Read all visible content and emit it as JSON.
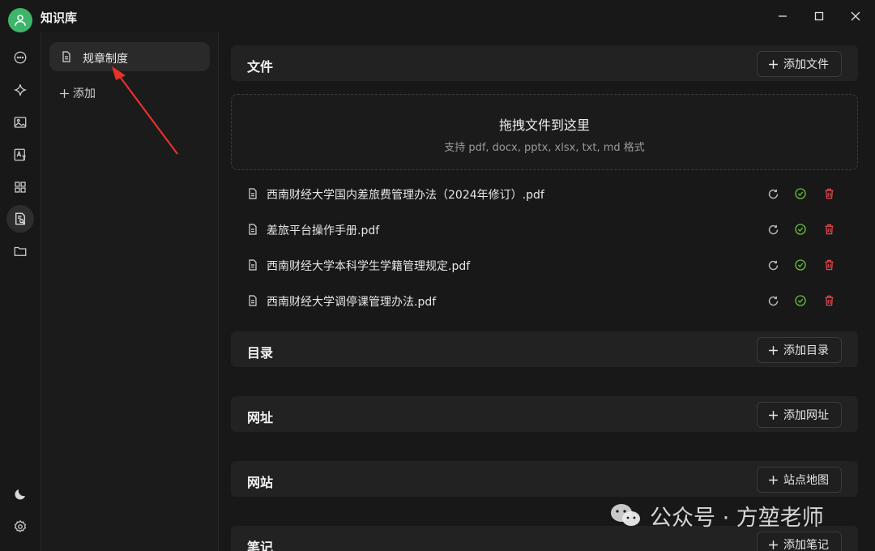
{
  "app": {
    "title": "知识库"
  },
  "window_controls": [
    "minimize",
    "maximize",
    "close"
  ],
  "rail": {
    "top_icons": [
      "chat-icon",
      "sparkle-icon",
      "image-icon",
      "translate-icon",
      "apps-icon",
      "knowledge-icon",
      "folder-icon"
    ],
    "active": "knowledge-icon",
    "bottom_icons": [
      "moon-icon",
      "settings-icon"
    ]
  },
  "kb_list": {
    "items": [
      {
        "label": "规章制度",
        "icon": "document-icon",
        "selected": true
      }
    ],
    "add_label": "添加"
  },
  "sections": {
    "files": {
      "title": "文件",
      "button": "添加文件"
    },
    "directory": {
      "title": "目录",
      "button": "添加目录"
    },
    "urls": {
      "title": "网址",
      "button": "添加网址"
    },
    "website": {
      "title": "网站",
      "button": "站点地图"
    },
    "notes": {
      "title": "笔记",
      "button": "添加笔记"
    }
  },
  "dropzone": {
    "title": "拖拽文件到这里",
    "subtitle": "支持 pdf, docx, pptx, xlsx, txt, md 格式"
  },
  "files": [
    {
      "name": "西南财经大学国内差旅费管理办法（2024年修订）.pdf"
    },
    {
      "name": "差旅平台操作手册.pdf"
    },
    {
      "name": "西南财经大学本科学生学籍管理规定.pdf"
    },
    {
      "name": "西南财经大学调停课管理办法.pdf"
    }
  ],
  "file_actions": [
    "refresh-icon",
    "check-circle-icon",
    "trash-icon"
  ],
  "colors": {
    "accent_green": "#3fb56b",
    "check_green": "#67c23a",
    "delete_red": "#e5484d",
    "annotation_red": "#e8302a"
  },
  "watermark": {
    "text": "公众号 · 方堃老师"
  }
}
